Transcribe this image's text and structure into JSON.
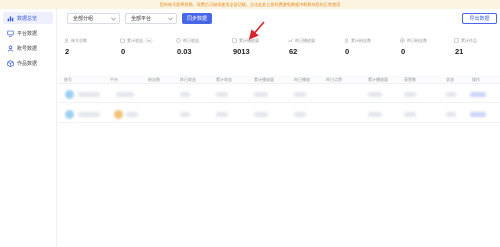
{
  "banner": {
    "text": "您的账号即将到期，续费后可继续使用全部功能，点击此处立即续费避免数据中断影响您的正常使用"
  },
  "sidebar": {
    "items": [
      {
        "label": "数据总览",
        "icon": "chart-icon",
        "active": true
      },
      {
        "label": "平台数据",
        "icon": "monitor-icon",
        "active": false
      },
      {
        "label": "账号数据",
        "icon": "user-icon",
        "active": false
      },
      {
        "label": "作品数据",
        "icon": "box-icon",
        "active": false
      }
    ]
  },
  "toolbar": {
    "group_select": "全部分组",
    "platform_select": "全部平台",
    "sync_button": "同步数据",
    "export_button": "导出数据"
  },
  "stats": [
    {
      "label": "账号总数",
      "value": "2"
    },
    {
      "label": "累计收益（元）",
      "value": "0"
    },
    {
      "label": "昨日收益",
      "value": "0.03"
    },
    {
      "label": "累计播放量",
      "value": "9013"
    },
    {
      "label": "昨日播放量",
      "value": "62"
    },
    {
      "label": "累计粉丝数",
      "value": "0"
    },
    {
      "label": "昨日粉丝数",
      "value": "0"
    },
    {
      "label": "累计作品",
      "value": "21"
    }
  ],
  "table": {
    "headers": [
      "账号",
      "平台",
      "粉丝数",
      "昨日收益",
      "累计收益",
      "累计播放量",
      "昨日播放",
      "昨日点赞",
      "累计播放量",
      "获赞数",
      "状态",
      "操作"
    ]
  },
  "colors": {
    "accent": "#4766e8",
    "banner_bg": "#fdf3e1",
    "banner_text": "#e08a1c",
    "arrow": "#d9232d"
  }
}
